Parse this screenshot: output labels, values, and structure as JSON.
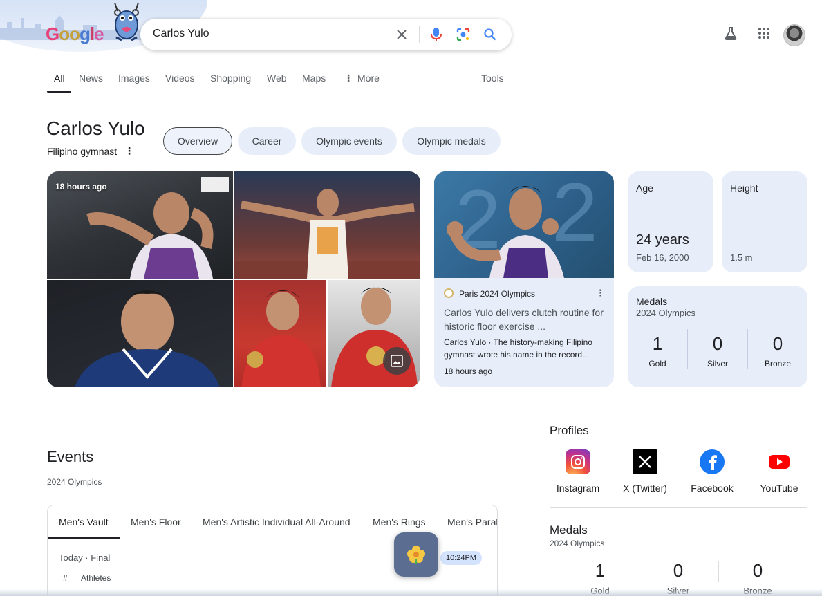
{
  "header": {
    "logo_text": "Google",
    "search_value": "Carlos Yulo",
    "icons": [
      "close-icon",
      "microphone-icon",
      "lens-icon",
      "search-icon",
      "labs-flask-icon",
      "apps-grid-icon",
      "account-avatar"
    ]
  },
  "tabs": [
    {
      "label": "All"
    },
    {
      "label": "News"
    },
    {
      "label": "Images"
    },
    {
      "label": "Videos"
    },
    {
      "label": "Shopping"
    },
    {
      "label": "Web"
    },
    {
      "label": "Maps"
    },
    {
      "label": "More"
    }
  ],
  "tools_label": "Tools",
  "entity": {
    "title": "Carlos Yulo",
    "subtitle": "Filipino gymnast",
    "chips": [
      "Overview",
      "Career",
      "Olympic events",
      "Olympic medals"
    ]
  },
  "images": {
    "badge_time": "18 hours ago"
  },
  "news": {
    "source": "Paris 2024 Olympics",
    "headline": "Carlos Yulo delivers clutch routine for historic floor exercise ...",
    "snippet": "Carlos Yulo · The history-making Filipino gymnast wrote his name in the record...",
    "time": "18 hours ago"
  },
  "facts": {
    "age_label": "Age",
    "age_value": "24 years",
    "age_date": "Feb 16, 2000",
    "height_label": "Height",
    "height_value": "1.5 m"
  },
  "medals": {
    "title": "Medals",
    "subtitle": "2024 Olympics",
    "items": [
      {
        "count": "1",
        "label": "Gold"
      },
      {
        "count": "0",
        "label": "Silver"
      },
      {
        "count": "0",
        "label": "Bronze"
      }
    ]
  },
  "events": {
    "title": "Events",
    "subtitle": "2024 Olympics",
    "tabs": [
      "Men's Vault",
      "Men's Floor",
      "Men's Artistic Individual All-Around",
      "Men's Rings",
      "Men's Paral"
    ],
    "date": "Today · Final",
    "time": "10:24PM",
    "col_hash": "#",
    "col_athletes": "Athletes"
  },
  "profiles": {
    "title": "Profiles",
    "items": [
      {
        "label": "Instagram",
        "icon": "instagram-icon"
      },
      {
        "label": "X (Twitter)",
        "icon": "x-twitter-icon"
      },
      {
        "label": "Facebook",
        "icon": "facebook-icon"
      },
      {
        "label": "YouTube",
        "icon": "youtube-icon"
      }
    ]
  },
  "right_medals": {
    "title": "Medals",
    "subtitle": "2024 Olympics",
    "items": [
      {
        "count": "1",
        "label": "Gold"
      },
      {
        "count": "0",
        "label": "Silver"
      },
      {
        "count": "0",
        "label": "Bronze"
      }
    ]
  },
  "colors": {
    "chip_bg": "#e8eef9",
    "accent_blue": "#1a73e8",
    "text": "#202124"
  }
}
